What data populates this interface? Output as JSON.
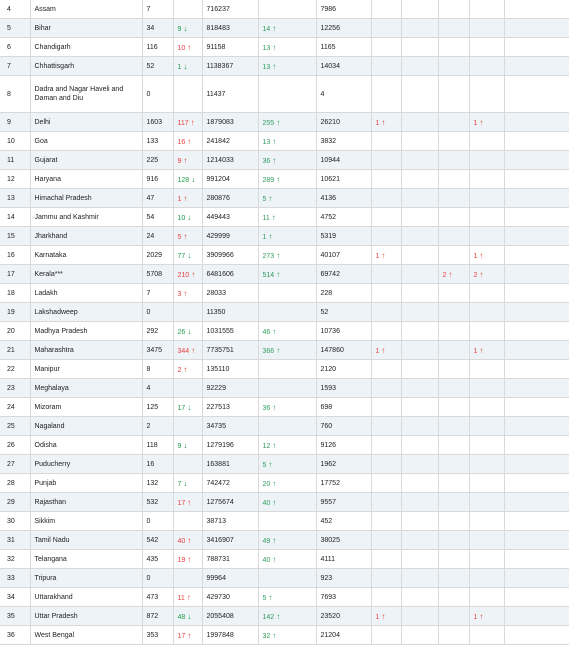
{
  "colors": {
    "up": "#e8413e",
    "down": "#1f9b4a",
    "recovered_delta": "#2e9d5b",
    "row_alt": "#eef3f8"
  },
  "rows": [
    {
      "sno": "4",
      "state": "Assam",
      "active": "7",
      "active_delta": "",
      "active_dir": "",
      "recovered": "716237",
      "recovered_delta": "",
      "deaths": "7986",
      "c1": "",
      "c2": "",
      "c3": ""
    },
    {
      "sno": "5",
      "state": "Bihar",
      "active": "34",
      "active_delta": "9",
      "active_dir": "down",
      "recovered": "818483",
      "recovered_delta": "14",
      "deaths": "12256",
      "c1": "",
      "c2": "",
      "c3": ""
    },
    {
      "sno": "6",
      "state": "Chandigarh",
      "active": "116",
      "active_delta": "10",
      "active_dir": "up",
      "recovered": "91158",
      "recovered_delta": "13",
      "deaths": "1165",
      "c1": "",
      "c2": "",
      "c3": ""
    },
    {
      "sno": "7",
      "state": "Chhattisgarh",
      "active": "52",
      "active_delta": "1",
      "active_dir": "down",
      "recovered": "1138367",
      "recovered_delta": "13",
      "deaths": "14034",
      "c1": "",
      "c2": "",
      "c3": ""
    },
    {
      "sno": "8",
      "state": "Dadra and Nagar Haveli and Daman and Diu",
      "active": "0",
      "active_delta": "",
      "active_dir": "",
      "recovered": "11437",
      "recovered_delta": "",
      "deaths": "4",
      "c1": "",
      "c2": "",
      "c3": "",
      "tall": true
    },
    {
      "sno": "9",
      "state": "Delhi",
      "active": "1603",
      "active_delta": "117",
      "active_dir": "up",
      "recovered": "1879083",
      "recovered_delta": "255",
      "deaths": "26210",
      "c1": "1",
      "c2": "",
      "c3": "1"
    },
    {
      "sno": "10",
      "state": "Goa",
      "active": "133",
      "active_delta": "16",
      "active_dir": "up",
      "recovered": "241842",
      "recovered_delta": "13",
      "deaths": "3832",
      "c1": "",
      "c2": "",
      "c3": ""
    },
    {
      "sno": "11",
      "state": "Gujarat",
      "active": "225",
      "active_delta": "9",
      "active_dir": "up",
      "recovered": "1214033",
      "recovered_delta": "36",
      "deaths": "10944",
      "c1": "",
      "c2": "",
      "c3": ""
    },
    {
      "sno": "12",
      "state": "Haryana",
      "active": "916",
      "active_delta": "128",
      "active_dir": "down",
      "recovered": "991204",
      "recovered_delta": "289",
      "deaths": "10621",
      "c1": "",
      "c2": "",
      "c3": ""
    },
    {
      "sno": "13",
      "state": "Himachal Pradesh",
      "active": "47",
      "active_delta": "1",
      "active_dir": "up",
      "recovered": "280876",
      "recovered_delta": "5",
      "deaths": "4136",
      "c1": "",
      "c2": "",
      "c3": ""
    },
    {
      "sno": "14",
      "state": "Jammu and Kashmir",
      "active": "54",
      "active_delta": "10",
      "active_dir": "down",
      "recovered": "449443",
      "recovered_delta": "11",
      "deaths": "4752",
      "c1": "",
      "c2": "",
      "c3": ""
    },
    {
      "sno": "15",
      "state": "Jharkhand",
      "active": "24",
      "active_delta": "5",
      "active_dir": "up",
      "recovered": "429999",
      "recovered_delta": "1",
      "deaths": "5319",
      "c1": "",
      "c2": "",
      "c3": ""
    },
    {
      "sno": "16",
      "state": "Karnataka",
      "active": "2029",
      "active_delta": "77",
      "active_dir": "down",
      "recovered": "3909966",
      "recovered_delta": "273",
      "deaths": "40107",
      "c1": "1",
      "c2": "",
      "c3": "1"
    },
    {
      "sno": "17",
      "state": "Kerala***",
      "active": "5708",
      "active_delta": "210",
      "active_dir": "up",
      "recovered": "6481606",
      "recovered_delta": "514",
      "deaths": "69742",
      "c1": "",
      "c2": "2",
      "c3": "2"
    },
    {
      "sno": "18",
      "state": "Ladakh",
      "active": "7",
      "active_delta": "3",
      "active_dir": "up",
      "recovered": "28033",
      "recovered_delta": "",
      "deaths": "228",
      "c1": "",
      "c2": "",
      "c3": ""
    },
    {
      "sno": "19",
      "state": "Lakshadweep",
      "active": "0",
      "active_delta": "",
      "active_dir": "",
      "recovered": "11350",
      "recovered_delta": "",
      "deaths": "52",
      "c1": "",
      "c2": "",
      "c3": ""
    },
    {
      "sno": "20",
      "state": "Madhya Pradesh",
      "active": "292",
      "active_delta": "26",
      "active_dir": "down",
      "recovered": "1031555",
      "recovered_delta": "46",
      "deaths": "10736",
      "c1": "",
      "c2": "",
      "c3": ""
    },
    {
      "sno": "21",
      "state": "Maharashtra",
      "active": "3475",
      "active_delta": "344",
      "active_dir": "up",
      "recovered": "7735751",
      "recovered_delta": "366",
      "deaths": "147860",
      "c1": "1",
      "c2": "",
      "c3": "1"
    },
    {
      "sno": "22",
      "state": "Manipur",
      "active": "8",
      "active_delta": "2",
      "active_dir": "up",
      "recovered": "135110",
      "recovered_delta": "",
      "deaths": "2120",
      "c1": "",
      "c2": "",
      "c3": ""
    },
    {
      "sno": "23",
      "state": "Meghalaya",
      "active": "4",
      "active_delta": "",
      "active_dir": "",
      "recovered": "92229",
      "recovered_delta": "",
      "deaths": "1593",
      "c1": "",
      "c2": "",
      "c3": ""
    },
    {
      "sno": "24",
      "state": "Mizoram",
      "active": "125",
      "active_delta": "17",
      "active_dir": "down",
      "recovered": "227513",
      "recovered_delta": "36",
      "deaths": "698",
      "c1": "",
      "c2": "",
      "c3": ""
    },
    {
      "sno": "25",
      "state": "Nagaland",
      "active": "2",
      "active_delta": "",
      "active_dir": "",
      "recovered": "34735",
      "recovered_delta": "",
      "deaths": "760",
      "c1": "",
      "c2": "",
      "c3": ""
    },
    {
      "sno": "26",
      "state": "Odisha",
      "active": "118",
      "active_delta": "9",
      "active_dir": "down",
      "recovered": "1279196",
      "recovered_delta": "12",
      "deaths": "9126",
      "c1": "",
      "c2": "",
      "c3": ""
    },
    {
      "sno": "27",
      "state": "Puducherry",
      "active": "16",
      "active_delta": "",
      "active_dir": "",
      "recovered": "163881",
      "recovered_delta": "5",
      "deaths": "1962",
      "c1": "",
      "c2": "",
      "c3": ""
    },
    {
      "sno": "28",
      "state": "Punjab",
      "active": "132",
      "active_delta": "7",
      "active_dir": "down",
      "recovered": "742472",
      "recovered_delta": "20",
      "deaths": "17752",
      "c1": "",
      "c2": "",
      "c3": ""
    },
    {
      "sno": "29",
      "state": "Rajasthan",
      "active": "532",
      "active_delta": "17",
      "active_dir": "up",
      "recovered": "1275674",
      "recovered_delta": "40",
      "deaths": "9557",
      "c1": "",
      "c2": "",
      "c3": ""
    },
    {
      "sno": "30",
      "state": "Sikkim",
      "active": "0",
      "active_delta": "",
      "active_dir": "",
      "recovered": "38713",
      "recovered_delta": "",
      "deaths": "452",
      "c1": "",
      "c2": "",
      "c3": ""
    },
    {
      "sno": "31",
      "state": "Tamil Nadu",
      "active": "542",
      "active_delta": "40",
      "active_dir": "up",
      "recovered": "3416907",
      "recovered_delta": "49",
      "deaths": "38025",
      "c1": "",
      "c2": "",
      "c3": ""
    },
    {
      "sno": "32",
      "state": "Telangana",
      "active": "435",
      "active_delta": "19",
      "active_dir": "up",
      "recovered": "788731",
      "recovered_delta": "40",
      "deaths": "4111",
      "c1": "",
      "c2": "",
      "c3": ""
    },
    {
      "sno": "33",
      "state": "Tripura",
      "active": "0",
      "active_delta": "",
      "active_dir": "",
      "recovered": "99964",
      "recovered_delta": "",
      "deaths": "923",
      "c1": "",
      "c2": "",
      "c3": ""
    },
    {
      "sno": "34",
      "state": "Uttarakhand",
      "active": "473",
      "active_delta": "11",
      "active_dir": "up",
      "recovered": "429730",
      "recovered_delta": "5",
      "deaths": "7693",
      "c1": "",
      "c2": "",
      "c3": ""
    },
    {
      "sno": "35",
      "state": "Uttar Pradesh",
      "active": "872",
      "active_delta": "48",
      "active_dir": "down",
      "recovered": "2055408",
      "recovered_delta": "142",
      "deaths": "23520",
      "c1": "1",
      "c2": "",
      "c3": "1"
    },
    {
      "sno": "36",
      "state": "West Bengal",
      "active": "353",
      "active_delta": "17",
      "active_dir": "up",
      "recovered": "1997848",
      "recovered_delta": "32",
      "deaths": "21204",
      "c1": "",
      "c2": "",
      "c3": ""
    }
  ]
}
